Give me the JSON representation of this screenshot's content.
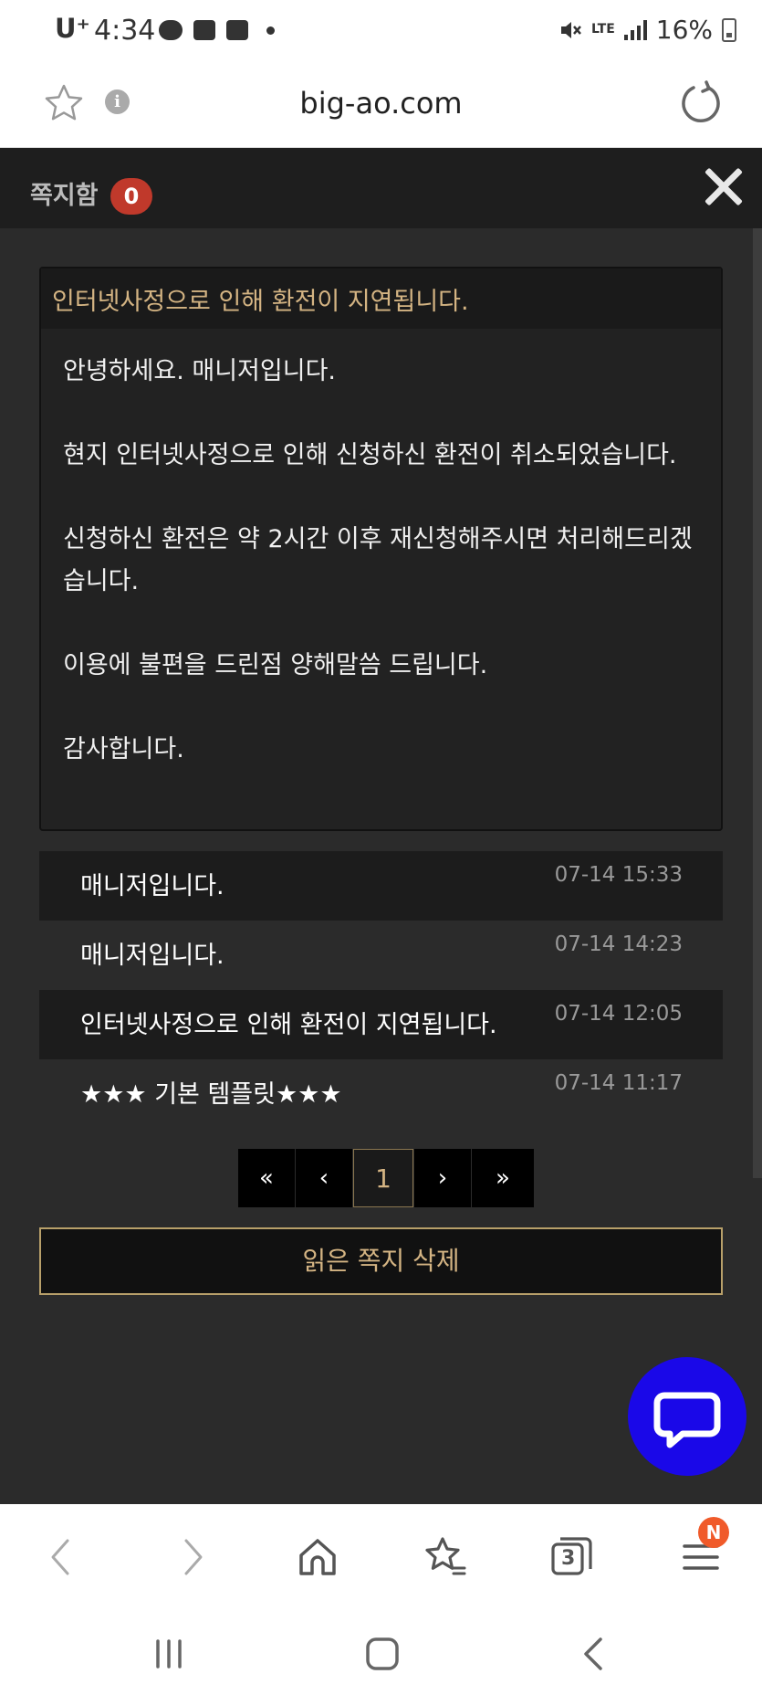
{
  "status_bar": {
    "carrier": "U⁺",
    "time": "4:34",
    "network": "LTE",
    "battery": "16%"
  },
  "browser": {
    "url": "big-ao.com"
  },
  "popup": {
    "title": "쪽지함",
    "unread_count": "0"
  },
  "message": {
    "subject": "인터넷사정으로 인해 환전이 지연됩니다.",
    "paragraphs": [
      "안녕하세요. 매니저입니다.",
      "현지 인터넷사정으로 인해 신청하신 환전이 취소되었습니다.",
      "신청하신 환전은 약 2시간 이후 재신청해주시면 처리해드리겠습니다.",
      "이용에 불편을 드린점 양해말씀 드립니다.",
      "감사합니다."
    ]
  },
  "inbox": [
    {
      "title": "매니저입니다.",
      "date": "07-14 15:33"
    },
    {
      "title": "매니저입니다.",
      "date": "07-14 14:23"
    },
    {
      "title": "인터넷사정으로 인해 환전이 지연됩니다.",
      "date": "07-14 12:05"
    },
    {
      "title": "★★★ 기본 템플릿★★★",
      "date": "07-14 11:17"
    }
  ],
  "pagination": {
    "first": "«",
    "prev": "‹",
    "current": "1",
    "next": "›",
    "last": "»"
  },
  "delete_read_label": "읽은 쪽지 삭제",
  "toolbar": {
    "tabs_count": "3",
    "menu_badge": "N"
  },
  "colors": {
    "accent_gold": "#d4b483",
    "badge_red": "#c0392b",
    "chat_blue": "#1a08e8"
  }
}
